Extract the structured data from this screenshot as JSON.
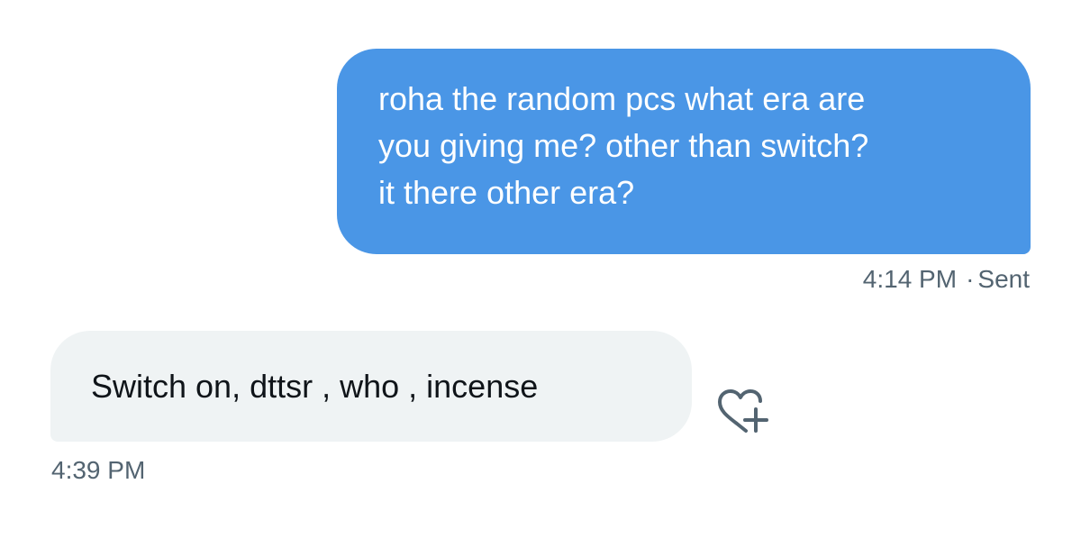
{
  "sent_message": {
    "lines": [
      "roha the random pcs what era are",
      "you giving me? other than switch?",
      "it there other era?"
    ],
    "time": "4:14 PM",
    "separator": "·",
    "status": "Sent",
    "bubble_color": "#4a96e6"
  },
  "received_message": {
    "text": "Switch on, dttsr , who , incense",
    "time": "4:39 PM",
    "bubble_color": "#eff3f4",
    "reaction_icon": "heart-plus-icon"
  }
}
